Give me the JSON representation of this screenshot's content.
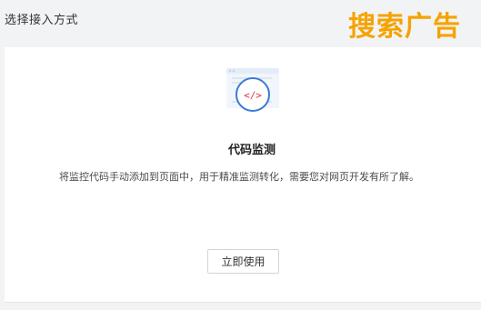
{
  "header": {
    "title": "选择接入方式",
    "watermark": "搜索广告"
  },
  "card": {
    "icon": "code-monitor-icon",
    "icon_glyph": "</>",
    "title": "代码监测",
    "description": "将监控代码手动添加到页面中，用于精准监测转化，需要您对网页开发有所了解。",
    "button_label": "立即使用"
  },
  "colors": {
    "page_background": "#f2f3f5",
    "card_background": "#ffffff",
    "watermark": "#f5a300",
    "icon_accent": "#3a7bd5",
    "icon_glyph": "#e8565f"
  }
}
